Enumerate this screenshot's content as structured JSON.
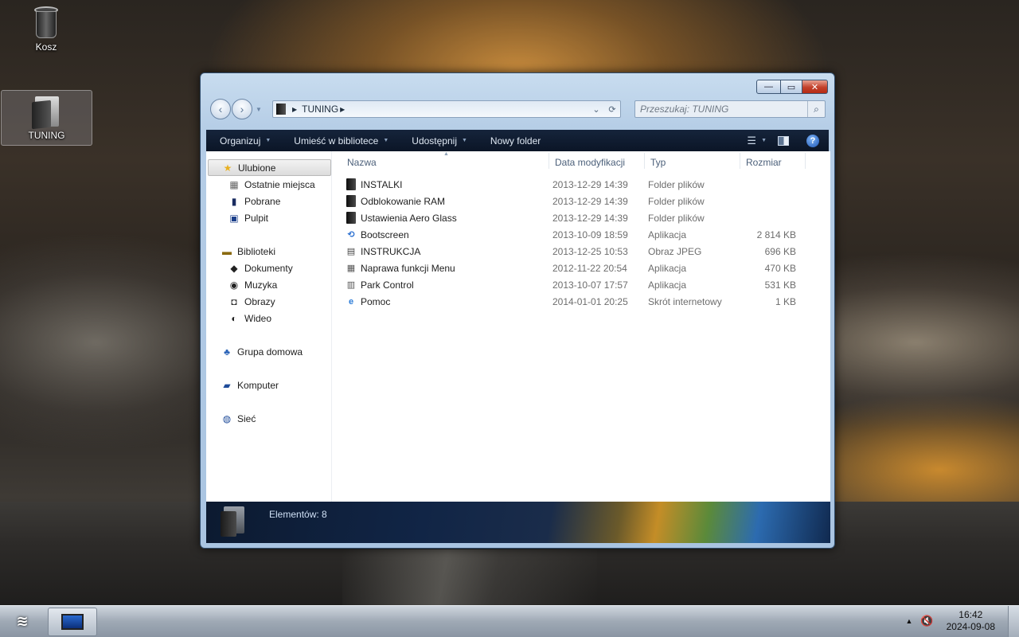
{
  "desktop": {
    "icons": [
      {
        "label": "Kosz",
        "icon": "recycle-bin-icon"
      },
      {
        "label": "TUNING",
        "icon": "folder-icon"
      }
    ]
  },
  "window": {
    "title_controls": {
      "minimize": "—",
      "maximize": "▭",
      "close": "✕"
    },
    "address": {
      "path": "TUNING"
    },
    "search": {
      "placeholder": "Przeszukaj: TUNING"
    },
    "toolbar": {
      "organize": "Organizuj",
      "include_library": "Umieść w bibliotece",
      "share": "Udostępnij",
      "new_folder": "Nowy folder"
    },
    "nav_pane": {
      "items": [
        {
          "label": "Ulubione",
          "icon": "star-icon"
        },
        {
          "label": "Ostatnie miejsca",
          "icon": "recent-places-icon"
        },
        {
          "label": "Pobrane",
          "icon": "downloads-icon"
        },
        {
          "label": "Pulpit",
          "icon": "desktop-icon"
        },
        {
          "label": "Biblioteki",
          "icon": "libraries-icon"
        },
        {
          "label": "Dokumenty",
          "icon": "documents-icon"
        },
        {
          "label": "Muzyka",
          "icon": "music-icon"
        },
        {
          "label": "Obrazy",
          "icon": "pictures-icon"
        },
        {
          "label": "Wideo",
          "icon": "video-icon"
        },
        {
          "label": "Grupa domowa",
          "icon": "homegroup-icon"
        },
        {
          "label": "Komputer",
          "icon": "computer-icon"
        },
        {
          "label": "Sieć",
          "icon": "network-icon"
        }
      ]
    },
    "columns": {
      "name": "Nazwa",
      "date": "Data modyfikacji",
      "type": "Typ",
      "size": "Rozmiar"
    },
    "files": [
      {
        "name": "INSTALKI",
        "date": "2013-12-29 14:39",
        "type": "Folder plików",
        "size": "",
        "icon": "folder-icon"
      },
      {
        "name": "Odblokowanie RAM",
        "date": "2013-12-29 14:39",
        "type": "Folder plików",
        "size": "",
        "icon": "folder-icon"
      },
      {
        "name": "Ustawienia Aero Glass",
        "date": "2013-12-29 14:39",
        "type": "Folder plików",
        "size": "",
        "icon": "folder-icon"
      },
      {
        "name": "Bootscreen",
        "date": "2013-10-09 18:59",
        "type": "Aplikacja",
        "size": "2 814 KB",
        "icon": "refresh-app-icon"
      },
      {
        "name": "INSTRUKCJA",
        "date": "2013-12-25 10:53",
        "type": "Obraz JPEG",
        "size": "696 KB",
        "icon": "jpeg-image-icon"
      },
      {
        "name": "Naprawa funkcji Menu",
        "date": "2012-11-22 20:54",
        "type": "Aplikacja",
        "size": "470 KB",
        "icon": "app-window-icon"
      },
      {
        "name": "Park Control",
        "date": "2013-10-07 17:57",
        "type": "Aplikacja",
        "size": "531 KB",
        "icon": "app-window-icon"
      },
      {
        "name": "Pomoc",
        "date": "2014-01-01 20:25",
        "type": "Skrót internetowy",
        "size": "1 KB",
        "icon": "internet-shortcut-icon"
      }
    ],
    "status": {
      "items_count": "Elementów: 8"
    }
  },
  "taskbar": {
    "clock_time": "16:42",
    "clock_date": "2024-09-08"
  }
}
